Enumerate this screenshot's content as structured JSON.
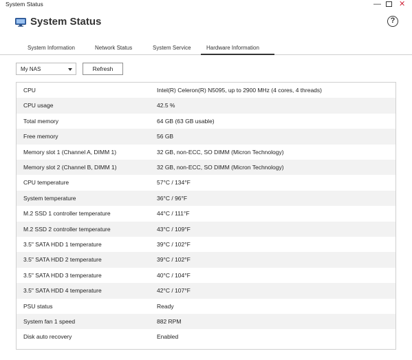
{
  "window": {
    "title": "System Status",
    "controls": {
      "minimize": "—",
      "close": "✕"
    }
  },
  "header": {
    "title": "System Status",
    "icon": "monitor-icon",
    "help": "?"
  },
  "tabs": [
    {
      "label": "System Information",
      "active": false
    },
    {
      "label": "Network Status",
      "active": false
    },
    {
      "label": "System Service",
      "active": false
    },
    {
      "label": "Hardware Information",
      "active": true
    }
  ],
  "toolbar": {
    "device_select": "My NAS",
    "refresh_label": "Refresh"
  },
  "hardware": [
    {
      "label": "CPU",
      "value": "Intel(R) Celeron(R) N5095, up to 2900 MHz (4 cores, 4 threads)"
    },
    {
      "label": "CPU usage",
      "value": "42.5 %"
    },
    {
      "label": "Total memory",
      "value": "64 GB (63 GB usable)"
    },
    {
      "label": "Free memory",
      "value": "56 GB"
    },
    {
      "label": "Memory slot 1 (Channel A, DIMM 1)",
      "value": "32 GB, non-ECC, SO DIMM (Micron Technology)"
    },
    {
      "label": "Memory slot 2 (Channel B, DIMM 1)",
      "value": "32 GB, non-ECC, SO DIMM (Micron Technology)"
    },
    {
      "label": "CPU temperature",
      "value": "57°C / 134°F"
    },
    {
      "label": "System temperature",
      "value": "36°C / 96°F"
    },
    {
      "label": "M.2 SSD 1 controller temperature",
      "value": "44°C / 111°F"
    },
    {
      "label": "M.2 SSD 2 controller temperature",
      "value": "43°C / 109°F"
    },
    {
      "label": "3.5\" SATA HDD 1 temperature",
      "value": "39°C / 102°F"
    },
    {
      "label": "3.5\" SATA HDD 2 temperature",
      "value": "39°C / 102°F"
    },
    {
      "label": "3.5\" SATA HDD 3 temperature",
      "value": "40°C / 104°F"
    },
    {
      "label": "3.5\" SATA HDD 4 temperature",
      "value": "42°C / 107°F"
    },
    {
      "label": "PSU status",
      "value": "Ready"
    },
    {
      "label": "System fan 1 speed",
      "value": "882 RPM"
    },
    {
      "label": "Disk auto recovery",
      "value": "Enabled"
    }
  ]
}
